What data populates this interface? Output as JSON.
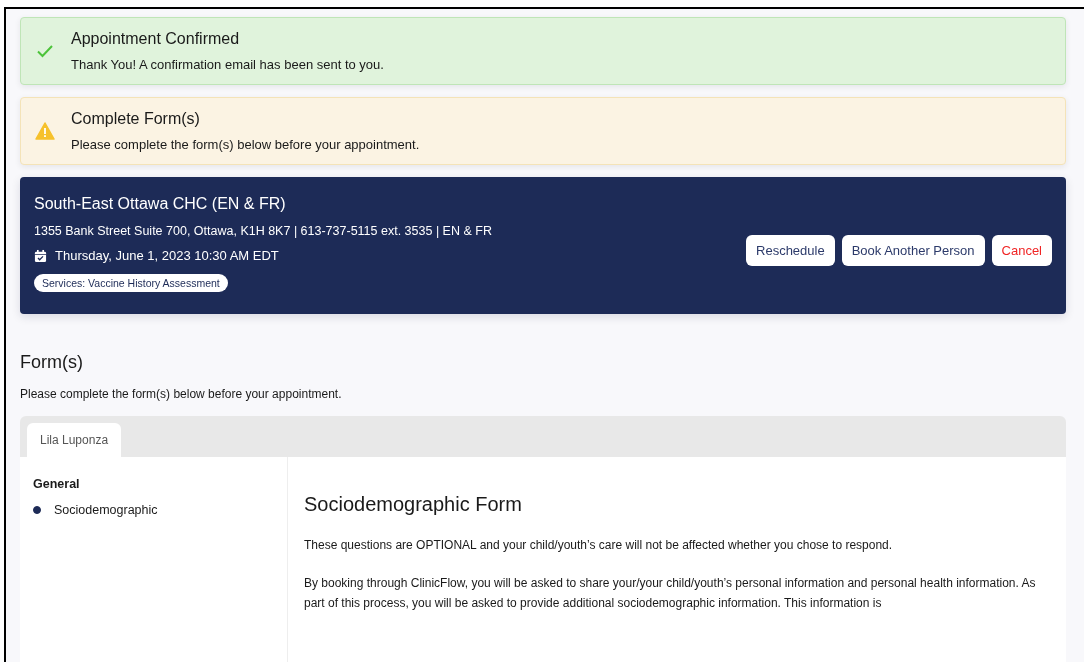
{
  "alerts": [
    {
      "kind": "success",
      "title": "Appointment Confirmed",
      "message": "Thank You! A confirmation email has been sent to you."
    },
    {
      "kind": "warning",
      "title": "Complete Form(s)",
      "message": "Please complete the form(s) below before your appointment."
    }
  ],
  "appointment": {
    "clinic": "South-East Ottawa CHC (EN & FR)",
    "address": "1355 Bank Street Suite 700, Ottawa, K1H 8K7 | 613-737-5115 ext. 3535 | EN & FR",
    "datetime": "Thursday, June 1, 2023 10:30 AM EDT",
    "services": "Services: Vaccine History Assessment",
    "buttons": [
      {
        "label": "Reschedule",
        "kind": "default"
      },
      {
        "label": "Book Another Person",
        "kind": "default"
      },
      {
        "label": "Cancel",
        "kind": "danger"
      }
    ]
  },
  "forms": {
    "heading": "Form(s)",
    "subtitle": "Please complete the form(s) below before your appointment.",
    "tabs": [
      {
        "label": "Lila Luponza",
        "selected": true
      }
    ],
    "sidebar": {
      "group": "General",
      "items": [
        {
          "label": "Sociodemographic",
          "selected": true
        }
      ]
    },
    "form_title": "Sociodemographic Form",
    "paragraphs": [
      "These questions are OPTIONAL and your child/youth’s care will not be affected whether you chose to respond.",
      "By booking through ClinicFlow, you will be asked to share your/your child/youth’s personal information and personal health information. As part of this process, you will be asked to provide additional sociodemographic information. This information is"
    ]
  }
}
